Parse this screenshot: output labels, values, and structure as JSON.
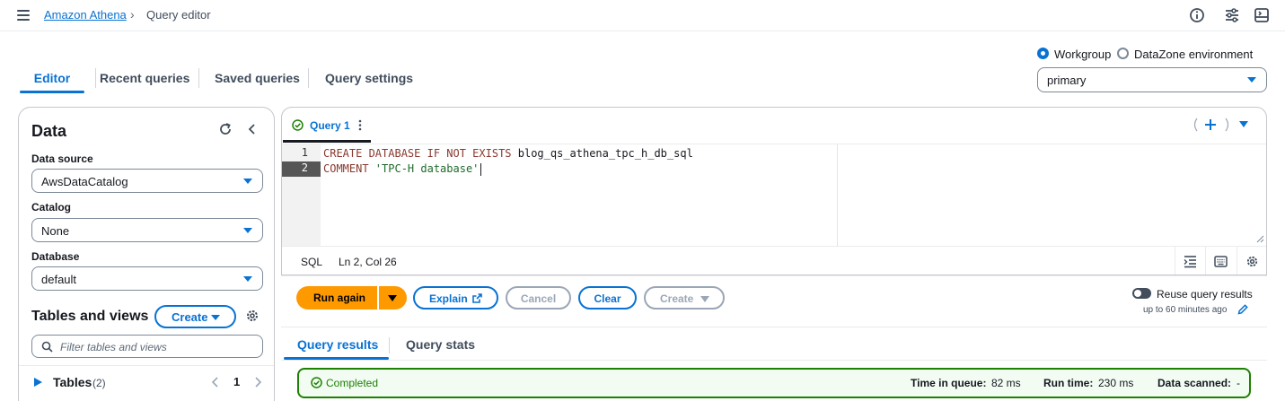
{
  "breadcrumb": {
    "root": "Amazon Athena",
    "separator": "›",
    "current": "Query editor"
  },
  "header_icons": [
    "menu-icon",
    "info-icon",
    "tune-icon",
    "split-panel-icon"
  ],
  "tabs": [
    {
      "label": "Editor",
      "active": true
    },
    {
      "label": "Recent queries",
      "active": false
    },
    {
      "label": "Saved queries",
      "active": false
    },
    {
      "label": "Query settings",
      "active": false
    }
  ],
  "scope": {
    "options": [
      {
        "label": "Workgroup",
        "checked": true
      },
      {
        "label": "DataZone environment",
        "checked": false
      }
    ],
    "workgroup_value": "primary"
  },
  "data_panel": {
    "title": "Data",
    "data_source_label": "Data source",
    "data_source_value": "AwsDataCatalog",
    "catalog_label": "Catalog",
    "catalog_value": "None",
    "database_label": "Database",
    "database_value": "default",
    "tables_views_title": "Tables and views",
    "create_label": "Create",
    "filter_placeholder": "Filter tables and views",
    "tables_label": "Tables",
    "tables_count": "(2)",
    "page": "1"
  },
  "editor": {
    "query_tab_label": "Query 1",
    "lines": [
      {
        "number": "1",
        "keyword": "CREATE DATABASE IF NOT EXISTS",
        "rest": " blog_qs_athena_tpc_h_db_sql"
      },
      {
        "number": "2",
        "keyword": "COMMENT",
        "rest": " 'TPC-H database'"
      }
    ],
    "language": "SQL",
    "cursor_position": "Ln 2, Col 26"
  },
  "actions": {
    "run_label": "Run again",
    "explain_label": "Explain",
    "cancel_label": "Cancel",
    "clear_label": "Clear",
    "create_label": "Create",
    "reuse_label": "Reuse query results",
    "reuse_sub": "up to 60 minutes ago"
  },
  "results": {
    "tabs": [
      "Query results",
      "Query stats"
    ],
    "status": "Completed",
    "time_in_queue_label": "Time in queue:",
    "time_in_queue_value": "82 ms",
    "run_time_label": "Run time:",
    "run_time_value": "230 ms",
    "data_scanned_label": "Data scanned:",
    "data_scanned_value": "-"
  },
  "colors": {
    "link_blue": "#0972d3",
    "run_orange": "#ff9900",
    "success_green": "#1d8102",
    "success_bg": "#f2fcf3",
    "text_dark": "#16191f"
  }
}
